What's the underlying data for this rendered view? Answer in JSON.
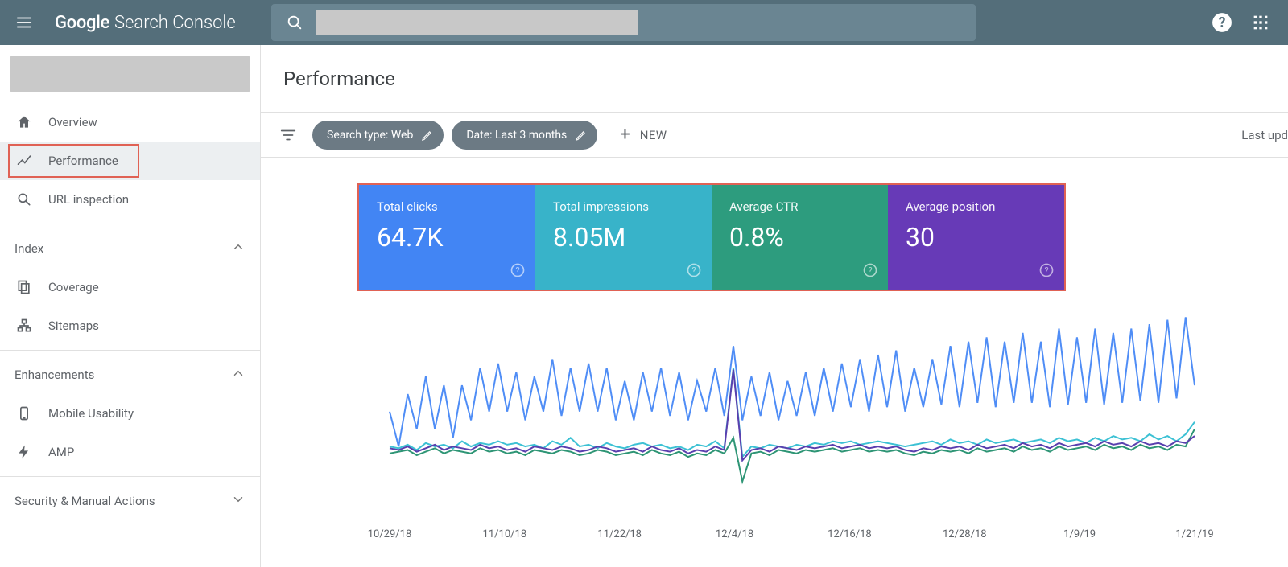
{
  "brand": {
    "google": "Google",
    "product": "Search Console"
  },
  "page": {
    "title": "Performance"
  },
  "sidebar": {
    "items": {
      "overview": "Overview",
      "performance": "Performance",
      "url": "URL inspection",
      "coverage": "Coverage",
      "sitemaps": "Sitemaps",
      "mobile": "Mobile Usability",
      "amp": "AMP"
    },
    "sections": {
      "index": "Index",
      "enh": "Enhancements",
      "sec": "Security & Manual Actions"
    }
  },
  "filters": {
    "searchtype": "Search type: Web",
    "date": "Date: Last 3 months",
    "new": "NEW",
    "updated": "Last upd"
  },
  "metrics": {
    "clicks": {
      "label": "Total clicks",
      "value": "64.7K",
      "color": "#4285f4"
    },
    "impressions": {
      "label": "Total impressions",
      "value": "8.05M",
      "color": "#38b3c9"
    },
    "ctr": {
      "label": "Average CTR",
      "value": "0.8%",
      "color": "#2d9c7e"
    },
    "position": {
      "label": "Average position",
      "value": "30",
      "color": "#673ab7"
    }
  },
  "chart_data": {
    "type": "line",
    "xlabel": "",
    "ylabel": "",
    "x_ticks": [
      "10/29/18",
      "11/10/18",
      "11/22/18",
      "12/4/18",
      "12/16/18",
      "12/28/18",
      "1/9/19",
      "1/21/19"
    ],
    "series": [
      {
        "name": "Total clicks",
        "color": "#4f8df6",
        "values": [
          120,
          80,
          140,
          100,
          160,
          100,
          150,
          90,
          150,
          110,
          170,
          120,
          175,
          120,
          165,
          110,
          160,
          120,
          180,
          115,
          170,
          120,
          175,
          120,
          170,
          110,
          155,
          110,
          165,
          120,
          170,
          115,
          165,
          110,
          155,
          120,
          170,
          115,
          195,
          110,
          160,
          115,
          165,
          110,
          155,
          115,
          165,
          115,
          170,
          120,
          175,
          125,
          180,
          120,
          185,
          125,
          190,
          120,
          170,
          125,
          180,
          128,
          195,
          125,
          200,
          130,
          205,
          125,
          200,
          130,
          210,
          130,
          200,
          125,
          215,
          128,
          205,
          130,
          215,
          128,
          210,
          130,
          215,
          132,
          220,
          130,
          225,
          135,
          228,
          150
        ]
      },
      {
        "name": "Total impressions",
        "color": "#3cc1d4",
        "values": [
          80,
          78,
          82,
          76,
          84,
          80,
          82,
          78,
          86,
          80,
          84,
          82,
          86,
          82,
          84,
          80,
          82,
          78,
          86,
          82,
          90,
          80,
          82,
          78,
          84,
          80,
          78,
          82,
          84,
          80,
          82,
          78,
          80,
          76,
          82,
          80,
          86,
          78,
          170,
          68,
          80,
          78,
          82,
          80,
          78,
          82,
          80,
          84,
          82,
          86,
          84,
          86,
          82,
          84,
          86,
          84,
          82,
          80,
          82,
          84,
          86,
          82,
          88,
          84,
          86,
          82,
          88,
          84,
          86,
          88,
          84,
          86,
          88,
          84,
          90,
          86,
          88,
          84,
          90,
          86,
          92,
          88,
          90,
          86,
          94,
          88,
          92,
          86,
          94,
          108
        ]
      },
      {
        "name": "Average CTR",
        "color": "#2e9575",
        "values": [
          72,
          74,
          76,
          70,
          74,
          78,
          72,
          76,
          74,
          72,
          78,
          74,
          76,
          72,
          74,
          70,
          76,
          74,
          72,
          76,
          74,
          70,
          72,
          76,
          74,
          70,
          72,
          74,
          70,
          76,
          72,
          70,
          74,
          68,
          72,
          70,
          76,
          72,
          90,
          40,
          72,
          74,
          70,
          76,
          74,
          72,
          76,
          74,
          76,
          78,
          74,
          76,
          78,
          74,
          76,
          74,
          76,
          72,
          70,
          74,
          72,
          76,
          74,
          76,
          72,
          78,
          74,
          76,
          78,
          74,
          80,
          76,
          78,
          74,
          80,
          76,
          78,
          80,
          76,
          82,
          78,
          80,
          76,
          82,
          78,
          80,
          76,
          82,
          80,
          100
        ]
      },
      {
        "name": "Average position",
        "color": "#5a3fae",
        "values": [
          78,
          76,
          80,
          74,
          78,
          82,
          76,
          80,
          78,
          76,
          82,
          78,
          80,
          76,
          78,
          74,
          80,
          78,
          76,
          80,
          78,
          74,
          76,
          80,
          78,
          74,
          76,
          78,
          74,
          80,
          76,
          74,
          78,
          72,
          76,
          74,
          80,
          76,
          168,
          64,
          76,
          78,
          74,
          80,
          78,
          76,
          80,
          78,
          80,
          82,
          78,
          80,
          82,
          78,
          80,
          78,
          80,
          76,
          74,
          78,
          76,
          80,
          78,
          80,
          76,
          82,
          78,
          80,
          82,
          78,
          84,
          80,
          82,
          78,
          84,
          80,
          82,
          84,
          80,
          86,
          82,
          84,
          80,
          86,
          82,
          84,
          80,
          86,
          84,
          92
        ]
      }
    ]
  }
}
